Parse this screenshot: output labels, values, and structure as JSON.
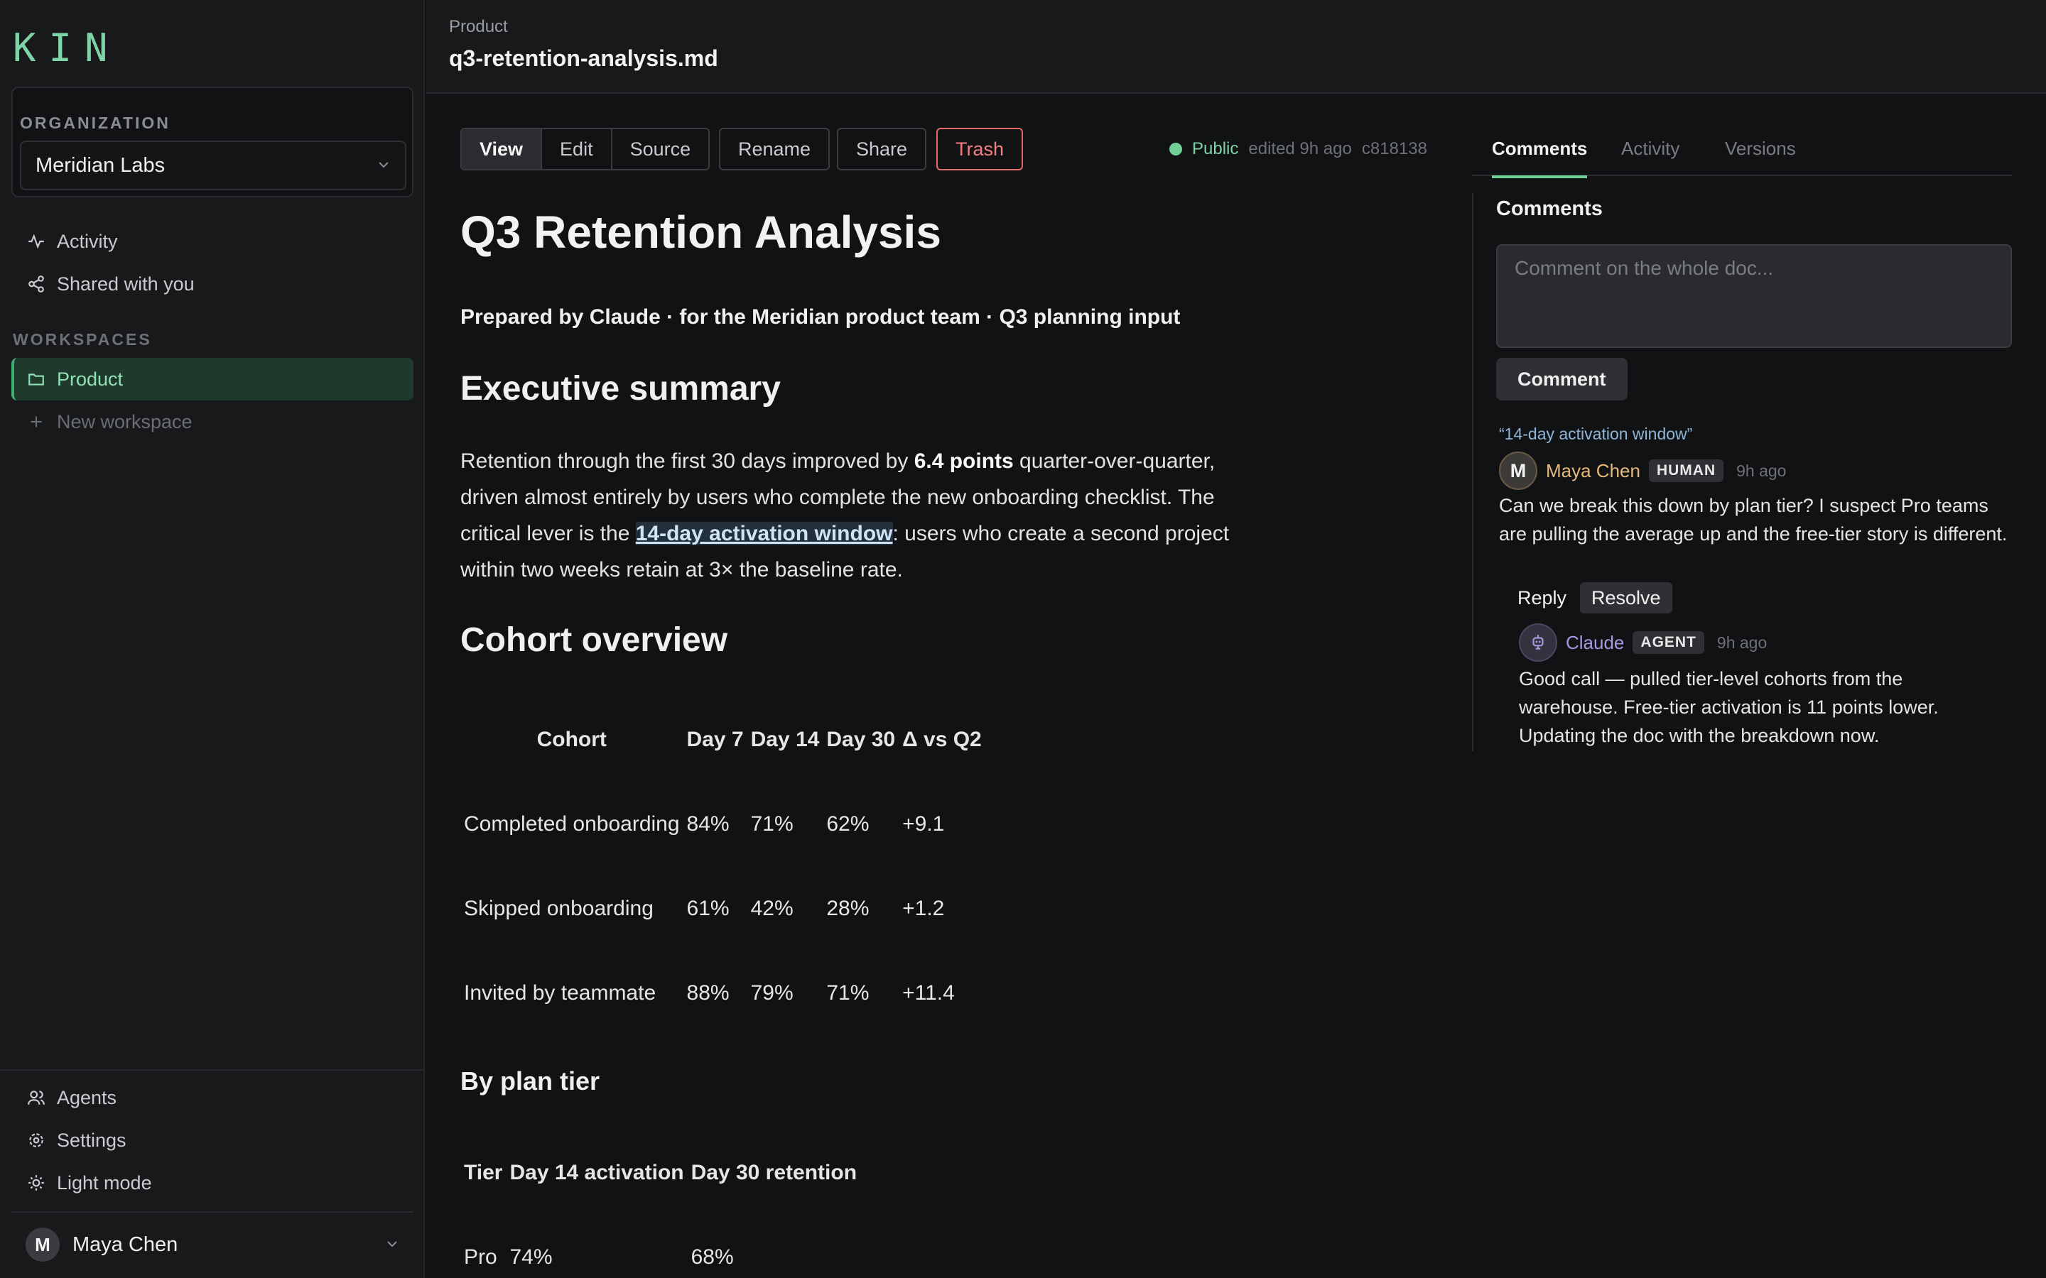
{
  "app": {
    "logo": "KIN"
  },
  "sidebar": {
    "org_label": "ORGANIZATION",
    "org_name": "Meridian Labs",
    "top_nav": [
      {
        "label": "Activity",
        "icon": "activity-icon"
      },
      {
        "label": "Shared with you",
        "icon": "share-icon"
      }
    ],
    "workspaces_label": "WORKSPACES",
    "workspaces": [
      {
        "label": "Product",
        "icon": "folder-icon",
        "active": true
      },
      {
        "label": "New workspace",
        "icon": "plus-icon",
        "active": false
      }
    ],
    "bottom_nav": [
      {
        "label": "Agents",
        "icon": "users-icon"
      },
      {
        "label": "Settings",
        "icon": "gear-icon"
      },
      {
        "label": "Light mode",
        "icon": "sun-icon"
      }
    ],
    "user": {
      "initial": "M",
      "name": "Maya Chen"
    }
  },
  "header": {
    "breadcrumb": "Product",
    "title": "q3-retention-analysis.md"
  },
  "toolbar": {
    "modes": [
      "View",
      "Edit",
      "Source"
    ],
    "active_mode": "View",
    "rename": "Rename",
    "share": "Share",
    "trash": "Trash",
    "visibility": "Public",
    "edited": "edited 9h ago",
    "commit": "c818138"
  },
  "document": {
    "h1": "Q3 Retention Analysis",
    "byline": "Prepared by Claude · for the Meridian product team · Q3 planning input",
    "exec_heading": "Executive summary",
    "exec_p1": "Retention through the first 30 days improved by ",
    "exec_bold": "6.4 points",
    "exec_p2": " quarter-over-quarter, driven almost entirely by users who complete the new onboarding checklist. The critical lever is the ",
    "exec_highlight": "14-day activation window",
    "exec_p3": ": users who create a second project within two weeks retain at 3× the baseline rate.",
    "cohort_heading": "Cohort overview",
    "cohort_table": {
      "headers": [
        "Cohort",
        "Day 7",
        "Day 14",
        "Day 30",
        "Δ vs Q2"
      ],
      "rows": [
        [
          "Completed onboarding",
          "84%",
          "71%",
          "62%",
          "+9.1"
        ],
        [
          "Skipped onboarding",
          "61%",
          "42%",
          "28%",
          "+1.2"
        ],
        [
          "Invited by teammate",
          "88%",
          "79%",
          "71%",
          "+11.4"
        ]
      ]
    },
    "tier_heading": "By plan tier",
    "tier_table": {
      "headers": [
        "Tier",
        "Day 14 activation",
        "Day 30 retention"
      ],
      "rows": [
        [
          "Pro",
          "74%",
          "68%"
        ]
      ]
    }
  },
  "panel": {
    "tabs": [
      "Comments",
      "Activity",
      "Versions"
    ],
    "active_tab": "Comments",
    "title": "Comments",
    "placeholder": "Comment on the whole doc...",
    "comment_button": "Comment",
    "thread": {
      "quote": "“14-day activation window”",
      "author": {
        "initial": "M",
        "name": "Maya Chen",
        "badge": "HUMAN",
        "time": "9h ago"
      },
      "body": "Can we break this down by plan tier? I suspect Pro teams are pulling the average up and the free-tier story is different.",
      "reply": "Reply",
      "resolve": "Resolve",
      "replies": [
        {
          "name": "Claude",
          "badge": "AGENT",
          "time": "9h ago",
          "body": "Good call — pulled tier-level cohorts from the warehouse. Free-tier activation is 11 points lower. Updating the doc with the breakdown now."
        }
      ]
    }
  },
  "colors": {
    "accent": "#6fcf97",
    "danger": "#e26a6a",
    "background": "#111214",
    "sidebar": "#18191b"
  }
}
